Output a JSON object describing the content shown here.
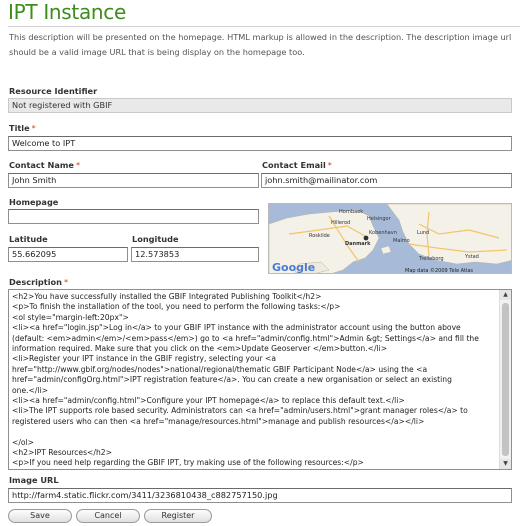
{
  "page": {
    "title": "IPT Instance",
    "intro": "This description will be presented on the homepage. HTML markup is allowed in the description. The description image url should be a valid image URL that is being display on the homepage too."
  },
  "form": {
    "resource_identifier": {
      "label": "Resource Identifier",
      "value": "Not registered with GBIF"
    },
    "title": {
      "label": "Title",
      "required_mark": "*",
      "value": "Welcome to IPT"
    },
    "contact_name": {
      "label": "Contact Name",
      "required_mark": "*",
      "value": "John Smith"
    },
    "contact_email": {
      "label": "Contact Email",
      "required_mark": "*",
      "value": "john.smith@mailinator.com"
    },
    "homepage": {
      "label": "Homepage",
      "value": ""
    },
    "latitude": {
      "label": "Latitude",
      "value": "55.662095"
    },
    "longitude": {
      "label": "Longitude",
      "value": "12.573853"
    },
    "description": {
      "label": "Description",
      "required_mark": "*",
      "lines": [
        "<h2>You have successfully installed the GBIF Integrated Publishing Toolkit</h2>",
        "<p>To finish the installation of the tool, you need to perform the following tasks:</p>",
        "<ol style=\"margin-left:20px\">",
        "  <li><a href=\"login.jsp\">Log in</a> to your GBIF IPT instance with the administrator account using the button above",
        "(default: <em>admin</em>/<em>pass</em>) go to <a href=\"admin/config.html\">Admin &gt; Settings</a> and fill the",
        "information required. Make sure that you click on the <em>Update Geoserver </em>button.</li>",
        "  <li>Register your IPT instance in the GBIF registry, selecting your <a",
        "href=\"http://www.gbif.org/nodes/nodes\">national/regional/thematic GBIF Participant Node</a> using the <a",
        "href=\"admin/configOrg.html\">IPT registration feature</a>. You can create a new organisation or select an existing",
        "one.</li>",
        "  <li><a href=\"admin/config.html\">Configure your IPT homepage</a> to replace this default text.</li>",
        "  <li>The IPT supports role based security. Administrators can <a href=\"admin/users.html\">grant manager roles</a> to",
        "registered users who can then <a href=\"manage/resources.html\">manage and publish resources</a></li>",
        "",
        "</ol>",
        "<h2>IPT Resources</h2>",
        "<p>If you need help regarding the GBIF IPT, try making use of the following resources:</p>"
      ]
    },
    "image_url": {
      "label": "Image URL",
      "value": "http://farm4.static.flickr.com/3411/3236810438_c882757150.jpg"
    }
  },
  "map": {
    "labels": [
      "Hornbaek",
      "Helsingor",
      "Hillerod",
      "Kobenhavn",
      "Danmark",
      "Malmo",
      "Lund",
      "Trelleborg",
      "Roskilde",
      "Ystad"
    ],
    "attribution": "Map data ©2009 Tele Atlas",
    "logo": "Google",
    "colors": {
      "water": "#a7bbd9",
      "land": "#f4f1e9",
      "road": "#f3c46a",
      "marker": "#2f2f2f"
    }
  },
  "buttons": {
    "save": "Save",
    "cancel": "Cancel",
    "register": "Register"
  },
  "colors": {
    "title": "#3d8c1e",
    "required": "#d43b1f"
  }
}
